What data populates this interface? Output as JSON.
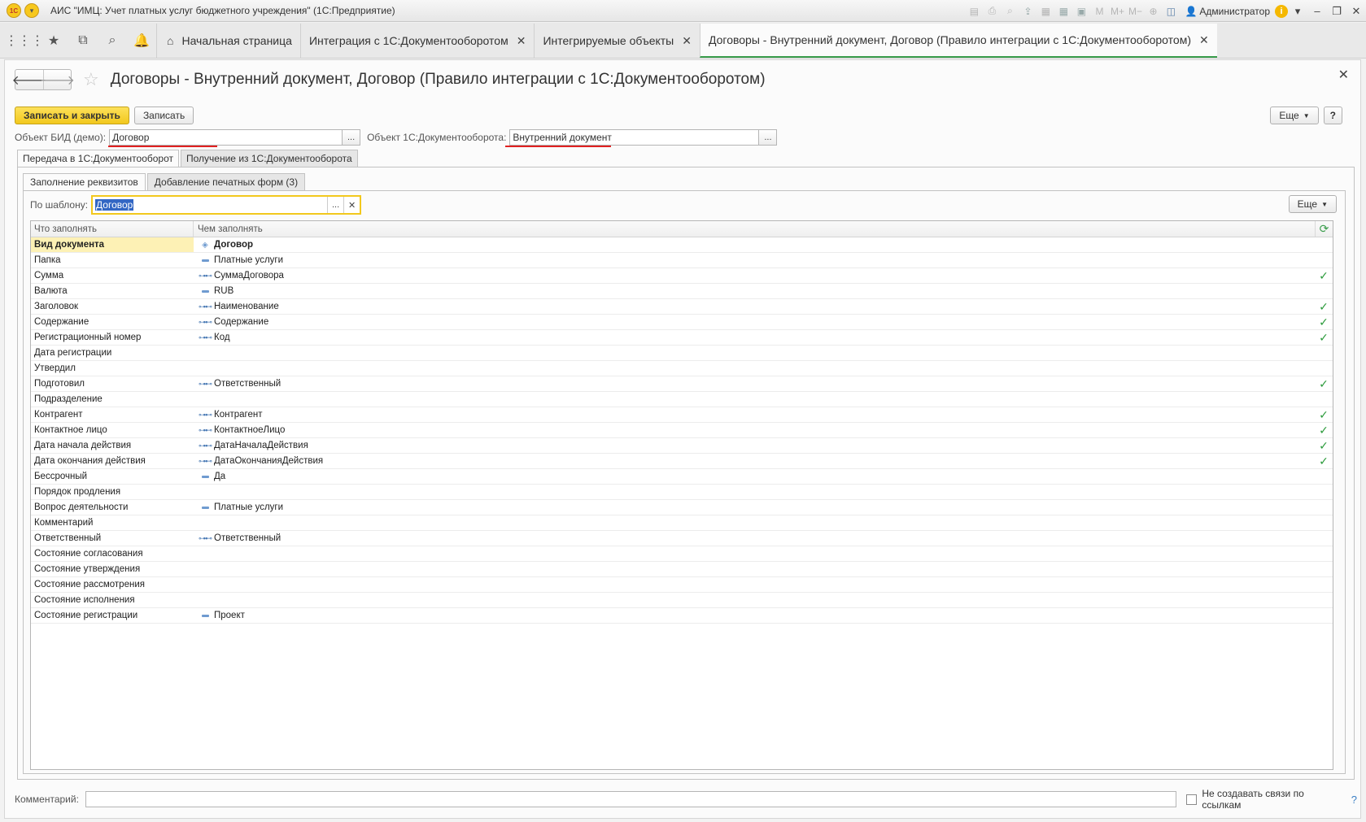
{
  "app": {
    "title": "АИС \"ИМЦ: Учет платных услуг бюджетного учреждения\"  (1С:Предприятие)",
    "user": "Администратор",
    "toolbar_icons": [
      "save-icon",
      "print-icon",
      "preview-icon",
      "upload-icon",
      "scan-icon",
      "calculator-icon",
      "calendar-icon",
      "m-icon",
      "m-plus-icon",
      "m-minus-icon",
      "zoom-icon",
      "panel-icon"
    ]
  },
  "tabs": [
    {
      "label": "Начальная страница",
      "closable": false
    },
    {
      "label": "Интеграция с 1С:Документооборотом",
      "closable": true
    },
    {
      "label": "Интегрируемые объекты",
      "closable": true
    },
    {
      "label": "Договоры - Внутренний документ, Договор (Правило интеграции с 1С:Документооборотом)",
      "closable": true,
      "active": true
    }
  ],
  "form": {
    "title": "Договоры - Внутренний документ, Договор (Правило интеграции с 1С:Документооборотом)",
    "buttons": {
      "save_close": "Записать и закрыть",
      "save": "Записать",
      "more": "Еще",
      "help": "?"
    },
    "object_bid_label": "Объект БИД (демо):",
    "object_bid_value": "Договор",
    "object_do_label": "Объект 1С:Документооборота:",
    "object_do_value": "Внутренний документ",
    "outer_tabs": [
      "Передача в 1С:Документооборот",
      "Получение из 1С:Документооборота"
    ],
    "inner_tabs": [
      "Заполнение реквизитов",
      "Добавление печатных форм (3)"
    ],
    "template_label": "По шаблону:",
    "template_value": "Договор",
    "grid": {
      "col_what": "Что заполнять",
      "col_with": "Чем заполнять",
      "rows": [
        {
          "what": "Вид документа",
          "icon": "diamond",
          "with": "Договор",
          "check": false,
          "selected": true
        },
        {
          "what": "Папка",
          "icon": "dash",
          "with": "Платные услуги",
          "check": false
        },
        {
          "what": "Сумма",
          "icon": "link",
          "with": "СуммаДоговора",
          "check": true
        },
        {
          "what": "Валюта",
          "icon": "dash",
          "with": "RUB",
          "check": false
        },
        {
          "what": "Заголовок",
          "icon": "link",
          "with": "Наименование",
          "check": true
        },
        {
          "what": "Содержание",
          "icon": "link",
          "with": "Содержание",
          "check": true
        },
        {
          "what": "Регистрационный номер",
          "icon": "link",
          "with": "Код",
          "check": true
        },
        {
          "what": "Дата регистрации",
          "icon": "",
          "with": "",
          "check": false
        },
        {
          "what": "Утвердил",
          "icon": "",
          "with": "",
          "check": false
        },
        {
          "what": "Подготовил",
          "icon": "link",
          "with": "Ответственный",
          "check": true
        },
        {
          "what": "Подразделение",
          "icon": "",
          "with": "",
          "check": false
        },
        {
          "what": "Контрагент",
          "icon": "link",
          "with": "Контрагент",
          "check": true
        },
        {
          "what": "Контактное лицо",
          "icon": "link",
          "with": "КонтактноеЛицо",
          "check": true
        },
        {
          "what": "Дата начала действия",
          "icon": "link",
          "with": "ДатаНачалаДействия",
          "check": true
        },
        {
          "what": "Дата окончания действия",
          "icon": "link",
          "with": "ДатаОкончанияДействия",
          "check": true
        },
        {
          "what": "Бессрочный",
          "icon": "dash",
          "with": "Да",
          "check": false
        },
        {
          "what": "Порядок продления",
          "icon": "",
          "with": "",
          "check": false
        },
        {
          "what": "Вопрос деятельности",
          "icon": "dash",
          "with": "Платные услуги",
          "check": false
        },
        {
          "what": "Комментарий",
          "icon": "",
          "with": "",
          "check": false
        },
        {
          "what": "Ответственный",
          "icon": "link",
          "with": "Ответственный",
          "check": false
        },
        {
          "what": "Состояние согласования",
          "icon": "",
          "with": "",
          "check": false
        },
        {
          "what": "Состояние утверждения",
          "icon": "",
          "with": "",
          "check": false
        },
        {
          "what": "Состояние рассмотрения",
          "icon": "",
          "with": "",
          "check": false
        },
        {
          "what": "Состояние исполнения",
          "icon": "",
          "with": "",
          "check": false
        },
        {
          "what": "Состояние регистрации",
          "icon": "dash",
          "with": "Проект",
          "check": false
        }
      ]
    },
    "comment_label": "Комментарий:",
    "comment_value": "",
    "no_links_label": "Не создавать связи по ссылкам"
  }
}
